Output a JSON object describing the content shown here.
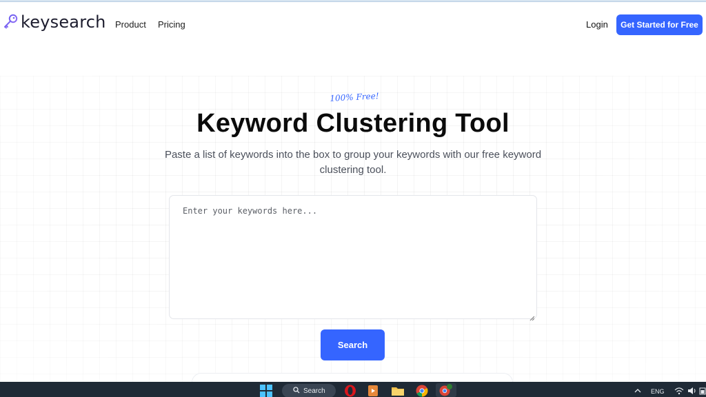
{
  "header": {
    "logo_text": "keysearch",
    "nav": [
      {
        "label": "Product"
      },
      {
        "label": "Pricing"
      }
    ],
    "login_label": "Login",
    "cta_label": "Get Started for Free"
  },
  "hero": {
    "badge": "100% Free!",
    "title": "Keyword Clustering Tool",
    "subtitle": "Paste a list of keywords into the box to group your keywords with our free keyword clustering tool."
  },
  "form": {
    "textarea_placeholder": "Enter your keywords here...",
    "textarea_value": "",
    "search_button_label": "Search"
  },
  "taskbar": {
    "search_label": "Search",
    "language": "ENG",
    "icons": [
      "windows-start-icon",
      "search-icon",
      "opera-icon",
      "media-player-icon",
      "file-explorer-icon",
      "chrome-icon",
      "chrome-profile-icon",
      "chevron-up-icon",
      "wifi-icon",
      "volume-icon",
      "battery-icon"
    ]
  },
  "colors": {
    "accent": "#3565ff",
    "title": "#0b0b0b",
    "subtitle": "#4a4f5a",
    "taskbar": "#1f2a36"
  }
}
